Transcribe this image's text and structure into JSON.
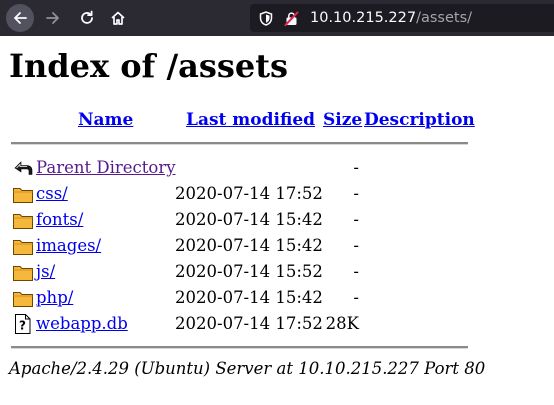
{
  "browser": {
    "url_host": "10.10.215.227",
    "url_path": "/assets/"
  },
  "page": {
    "title": "Index of /assets",
    "columns": {
      "name": "Name",
      "last_modified": "Last modified",
      "size": "Size",
      "description": "Description"
    },
    "rows": [
      {
        "icon": "back-icon",
        "name": "Parent Directory",
        "modified": "",
        "size": "-",
        "visited": true
      },
      {
        "icon": "folder-icon",
        "name": "css/",
        "modified": "2020-07-14 17:52",
        "size": "-",
        "visited": false
      },
      {
        "icon": "folder-icon",
        "name": "fonts/",
        "modified": "2020-07-14 15:42",
        "size": "-",
        "visited": false
      },
      {
        "icon": "folder-icon",
        "name": "images/",
        "modified": "2020-07-14 15:42",
        "size": "-",
        "visited": false
      },
      {
        "icon": "folder-icon",
        "name": "js/",
        "modified": "2020-07-14 15:52",
        "size": "-",
        "visited": false
      },
      {
        "icon": "folder-icon",
        "name": "php/",
        "modified": "2020-07-14 15:42",
        "size": "-",
        "visited": false
      },
      {
        "icon": "unknown-file-icon",
        "name": "webapp.db",
        "modified": "2020-07-14 17:52",
        "size": "28K",
        "visited": false
      }
    ],
    "server_signature": "Apache/2.4.29 (Ubuntu) Server at 10.10.215.227 Port 80"
  },
  "colors": {
    "link": "#0000ee",
    "visited_link": "#551a8b",
    "toolbar_bg": "#2b2a33",
    "urlbar_bg": "#1c1b22"
  }
}
